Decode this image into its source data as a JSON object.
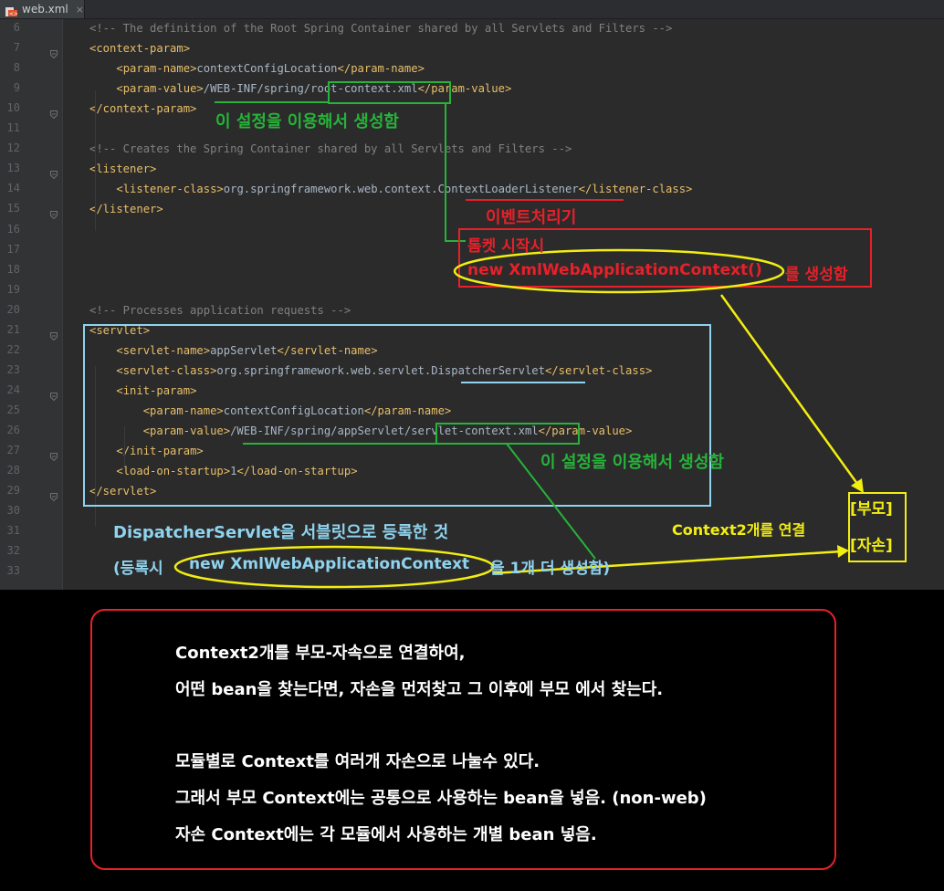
{
  "tab": {
    "filename": "web.xml",
    "close": "×",
    "icon": "xml-file-icon"
  },
  "editor": {
    "lines": [
      {
        "num": "6",
        "parts": [
          {
            "t": "cmt",
            "v": "<!-- The definition of the Root Spring Container shared by all Servlets and Filters -->"
          }
        ]
      },
      {
        "num": "7",
        "parts": [
          {
            "t": "tag",
            "v": "<context-param>"
          }
        ]
      },
      {
        "num": "8",
        "parts": [
          {
            "t": "txt",
            "v": "    "
          },
          {
            "t": "tag",
            "v": "<param-name>"
          },
          {
            "t": "txt",
            "v": "contextConfigLocation"
          },
          {
            "t": "tag",
            "v": "</param-name>"
          }
        ]
      },
      {
        "num": "9",
        "parts": [
          {
            "t": "txt",
            "v": "    "
          },
          {
            "t": "tag",
            "v": "<param-value>"
          },
          {
            "t": "txt",
            "v": "/WEB-INF/spring/root-context.xml"
          },
          {
            "t": "tag",
            "v": "</param-value>"
          }
        ]
      },
      {
        "num": "10",
        "parts": [
          {
            "t": "tag",
            "v": "</context-param>"
          }
        ]
      },
      {
        "num": "11",
        "parts": []
      },
      {
        "num": "12",
        "parts": [
          {
            "t": "cmt",
            "v": "<!-- Creates the Spring Container shared by all Servlets and Filters -->"
          }
        ]
      },
      {
        "num": "13",
        "parts": [
          {
            "t": "tag",
            "v": "<listener>"
          }
        ]
      },
      {
        "num": "14",
        "parts": [
          {
            "t": "txt",
            "v": "    "
          },
          {
            "t": "tag",
            "v": "<listener-class>"
          },
          {
            "t": "txt",
            "v": "org.springframework.web.context.ContextLoaderListener"
          },
          {
            "t": "tag",
            "v": "</listener-class>"
          }
        ]
      },
      {
        "num": "15",
        "parts": [
          {
            "t": "tag",
            "v": "</listener>"
          }
        ]
      },
      {
        "num": "16",
        "parts": []
      },
      {
        "num": "17",
        "parts": []
      },
      {
        "num": "18",
        "parts": []
      },
      {
        "num": "19",
        "parts": []
      },
      {
        "num": "20",
        "parts": [
          {
            "t": "cmt",
            "v": "<!-- Processes application requests -->"
          }
        ]
      },
      {
        "num": "21",
        "parts": [
          {
            "t": "tag",
            "v": "<servlet>"
          }
        ]
      },
      {
        "num": "22",
        "parts": [
          {
            "t": "txt",
            "v": "    "
          },
          {
            "t": "tag",
            "v": "<servlet-name>"
          },
          {
            "t": "txt",
            "v": "appServlet"
          },
          {
            "t": "tag",
            "v": "</servlet-name>"
          }
        ]
      },
      {
        "num": "23",
        "parts": [
          {
            "t": "txt",
            "v": "    "
          },
          {
            "t": "tag",
            "v": "<servlet-class>"
          },
          {
            "t": "txt",
            "v": "org.springframework.web.servlet.DispatcherServlet"
          },
          {
            "t": "tag",
            "v": "</servlet-class>"
          }
        ]
      },
      {
        "num": "24",
        "parts": [
          {
            "t": "txt",
            "v": "    "
          },
          {
            "t": "tag",
            "v": "<init-param>"
          }
        ]
      },
      {
        "num": "25",
        "parts": [
          {
            "t": "txt",
            "v": "        "
          },
          {
            "t": "tag",
            "v": "<param-name>"
          },
          {
            "t": "txt",
            "v": "contextConfigLocation"
          },
          {
            "t": "tag",
            "v": "</param-name>"
          }
        ]
      },
      {
        "num": "26",
        "parts": [
          {
            "t": "txt",
            "v": "        "
          },
          {
            "t": "tag",
            "v": "<param-value>"
          },
          {
            "t": "txt",
            "v": "/WEB-INF/spring/appServlet/servlet-context.xml"
          },
          {
            "t": "tag",
            "v": "</param-value>"
          }
        ]
      },
      {
        "num": "27",
        "parts": [
          {
            "t": "txt",
            "v": "    "
          },
          {
            "t": "tag",
            "v": "</init-param>"
          }
        ]
      },
      {
        "num": "28",
        "parts": [
          {
            "t": "txt",
            "v": "    "
          },
          {
            "t": "tag",
            "v": "<load-on-startup>"
          },
          {
            "t": "txt",
            "v": "1"
          },
          {
            "t": "tag",
            "v": "</load-on-startup>"
          }
        ]
      },
      {
        "num": "29",
        "parts": [
          {
            "t": "tag",
            "v": "</servlet>"
          }
        ]
      },
      {
        "num": "30",
        "parts": []
      },
      {
        "num": "31",
        "parts": []
      },
      {
        "num": "32",
        "parts": []
      },
      {
        "num": "33",
        "parts": []
      }
    ]
  },
  "annotations": {
    "root_config_note": "이 설정을 이용해서 생성함",
    "event_processor": "이벤트처리기",
    "tomcat_start": "톰켓 시작시",
    "new_root_context": "new XmlWebApplicationContext()",
    "create_suffix": "를 생성함",
    "servlet_config_note": "이 설정을 이용해서 생성함",
    "parent": "[부모]",
    "child": "[자손]",
    "connect_two": "Context2개를 연결",
    "dispatcher_registered": "DispatcherServlet을 서블릿으로 등록한 것",
    "register_prefix": "(등록시",
    "new_servlet_context": "new XmlWebApplicationContext",
    "register_suffix": "을 1개 더 생성함)"
  },
  "note": {
    "lines": [
      "Context2개를 부모-자속으로 연결하여,",
      "어떤 bean을 찾는다면, 자손을 먼저찾고 그 이후에 부모 에서 찾는다.",
      "모듈별로 Context를 여러개 자손으로 나눌수 있다.",
      "그래서 부모 Context에는 공통으로 사용하는 bean을 넣음. (non-web)",
      "자손 Context에는 각 모듈에서 사용하는 개별 bean 넣음."
    ]
  },
  "colors": {
    "green": "#27b33a",
    "red": "#e8202a",
    "yellow": "#f2ee12",
    "cyan": "#8fd3ee",
    "tag": "#e8bf6a",
    "comment": "#808080",
    "text": "#a9b7c6"
  }
}
